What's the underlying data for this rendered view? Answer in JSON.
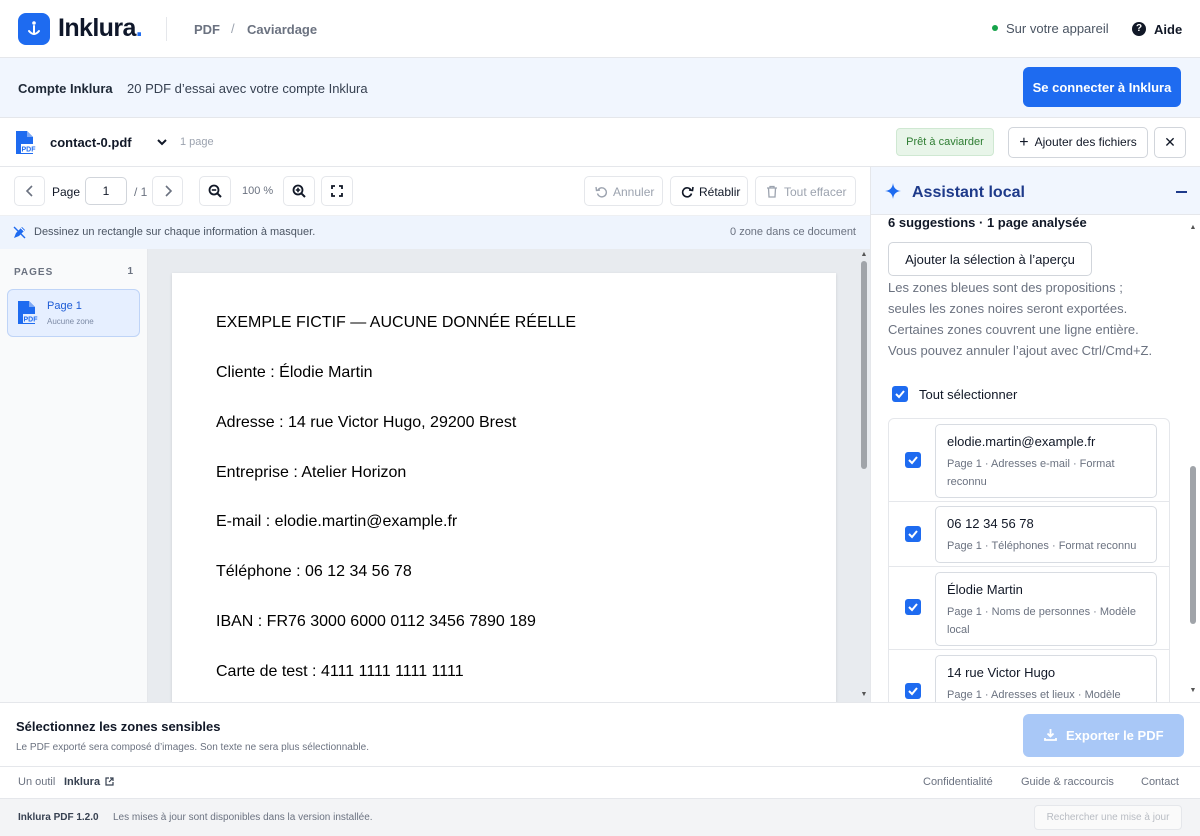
{
  "header": {
    "brand": "Inklura",
    "brand_dot": ".",
    "breadcrumb": [
      "PDF",
      "Caviardage"
    ],
    "breadcrumb_sep": "/",
    "device_status": "Sur votre appareil",
    "help_label": "Aide",
    "help_glyph": "?"
  },
  "account": {
    "title": "Compte Inklura",
    "description": "20 PDF d’essai avec votre compte Inklura",
    "connect_label": "Se connecter à Inklura"
  },
  "file": {
    "name": "contact-0.pdf",
    "pages_label": "1 page",
    "status_badge": "Prêt à caviarder",
    "add_files_label": "Ajouter des fichiers",
    "add_glyph": "+",
    "close_glyph": "✕"
  },
  "toolbar": {
    "page_label": "Page",
    "page_value": "1",
    "page_total": "/ 1",
    "zoom_level": "100 %",
    "undo_label": "Annuler",
    "redo_label": "Rétablir",
    "clear_label": "Tout effacer"
  },
  "hint": {
    "text": "Dessinez un rectangle sur chaque information à masquer.",
    "zone_count": "0 zone dans ce document"
  },
  "pages_panel": {
    "title": "PAGES",
    "count": "1",
    "items": [
      {
        "label": "Page 1",
        "sub": "Aucune zone"
      }
    ]
  },
  "document": {
    "lines": [
      "EXEMPLE FICTIF — AUCUNE DONNÉE RÉELLE",
      "Cliente : Élodie Martin",
      "Adresse : 14 rue Victor Hugo, 29200 Brest",
      "Entreprise : Atelier Horizon",
      "E-mail : elodie.martin@example.fr",
      "Téléphone : 06 12 34 56 78",
      "IBAN : FR76 3000 6000 0112 3456 7890 189",
      "Carte de test : 4111 1111 1111 1111"
    ]
  },
  "assistant": {
    "title": "Assistant local",
    "summary": "6 suggestions · 1 page analysée",
    "add_selection_label": "Ajouter la sélection à l’aperçu",
    "note_lines": [
      "Les zones bleues sont des propositions ;",
      "seules les zones noires seront exportées.",
      "Certaines zones couvrent une ligne entière.",
      "Vous pouvez annuler l’ajout avec Ctrl/Cmd+Z."
    ],
    "select_all_label": "Tout sélectionner",
    "suggestions": [
      {
        "value": "elodie.martin@example.fr",
        "meta": "Page 1 · Adresses e-mail · Format reconnu",
        "checked": true
      },
      {
        "value": "06 12 34 56 78",
        "meta": "Page 1 · Téléphones · Format reconnu",
        "checked": true
      },
      {
        "value": "Élodie Martin",
        "meta": "Page 1 · Noms de personnes · Modèle local",
        "checked": true
      },
      {
        "value": "14 rue Victor Hugo",
        "meta": "Page 1 · Adresses et lieux · Modèle",
        "checked": true
      }
    ]
  },
  "export": {
    "title": "Sélectionnez les zones sensibles",
    "description": "Le PDF exporté sera composé d’images. Son texte ne sera plus sélectionnable.",
    "button_label": "Exporter le PDF"
  },
  "footer": {
    "tool_prefix": "Un outil",
    "tool_brand": "Inklura",
    "links": [
      "Confidentialité",
      "Guide & raccourcis",
      "Contact"
    ]
  },
  "version": {
    "label": "Inklura PDF 1.2.0",
    "note": "Les mises à jour sont disponibles dans la version installée.",
    "update_button": "Rechercher une mise à jour"
  },
  "colors": {
    "accent": "#1e6bf0",
    "status_green": "#16a34a",
    "export_disabled": "#a9c8f7"
  }
}
